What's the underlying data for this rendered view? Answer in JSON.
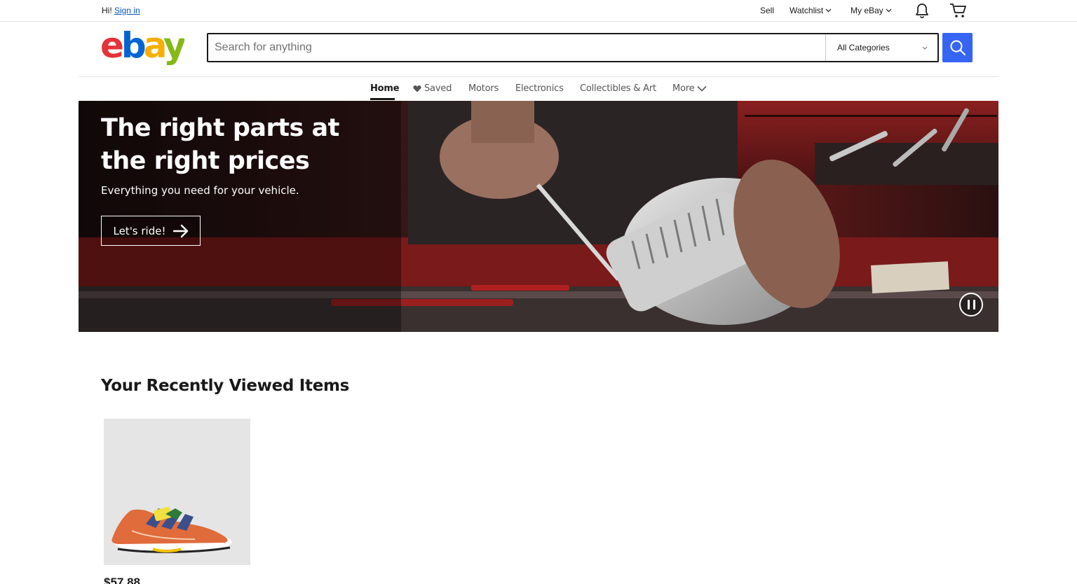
{
  "topbar": {
    "greeting": "Hi!",
    "signin": "Sign in",
    "sell": "Sell",
    "watchlist": "Watchlist",
    "myebay": "My eBay",
    "icons": [
      "bell-icon",
      "cart-icon"
    ]
  },
  "header": {
    "logo_text": "ebay",
    "search_placeholder": "Search for anything",
    "category": "All Categories"
  },
  "nav": {
    "items": [
      "Home",
      "Saved",
      "Motors",
      "Electronics",
      "Collectibles & Art",
      "More"
    ],
    "active": "Home"
  },
  "hero": {
    "title": "The right parts at the right prices",
    "subtitle": "Everything you need for your vehicle.",
    "cta": "Let's ride!"
  },
  "recent": {
    "title": "Your Recently Viewed Items",
    "items": [
      {
        "price": "$57.88"
      }
    ]
  },
  "colors": {
    "brand_red": "#e53238",
    "brand_blue": "#0064d2",
    "brand_yellow": "#f5af02",
    "brand_green": "#86b817",
    "search_button": "#3665f3",
    "link": "#0654ba"
  }
}
